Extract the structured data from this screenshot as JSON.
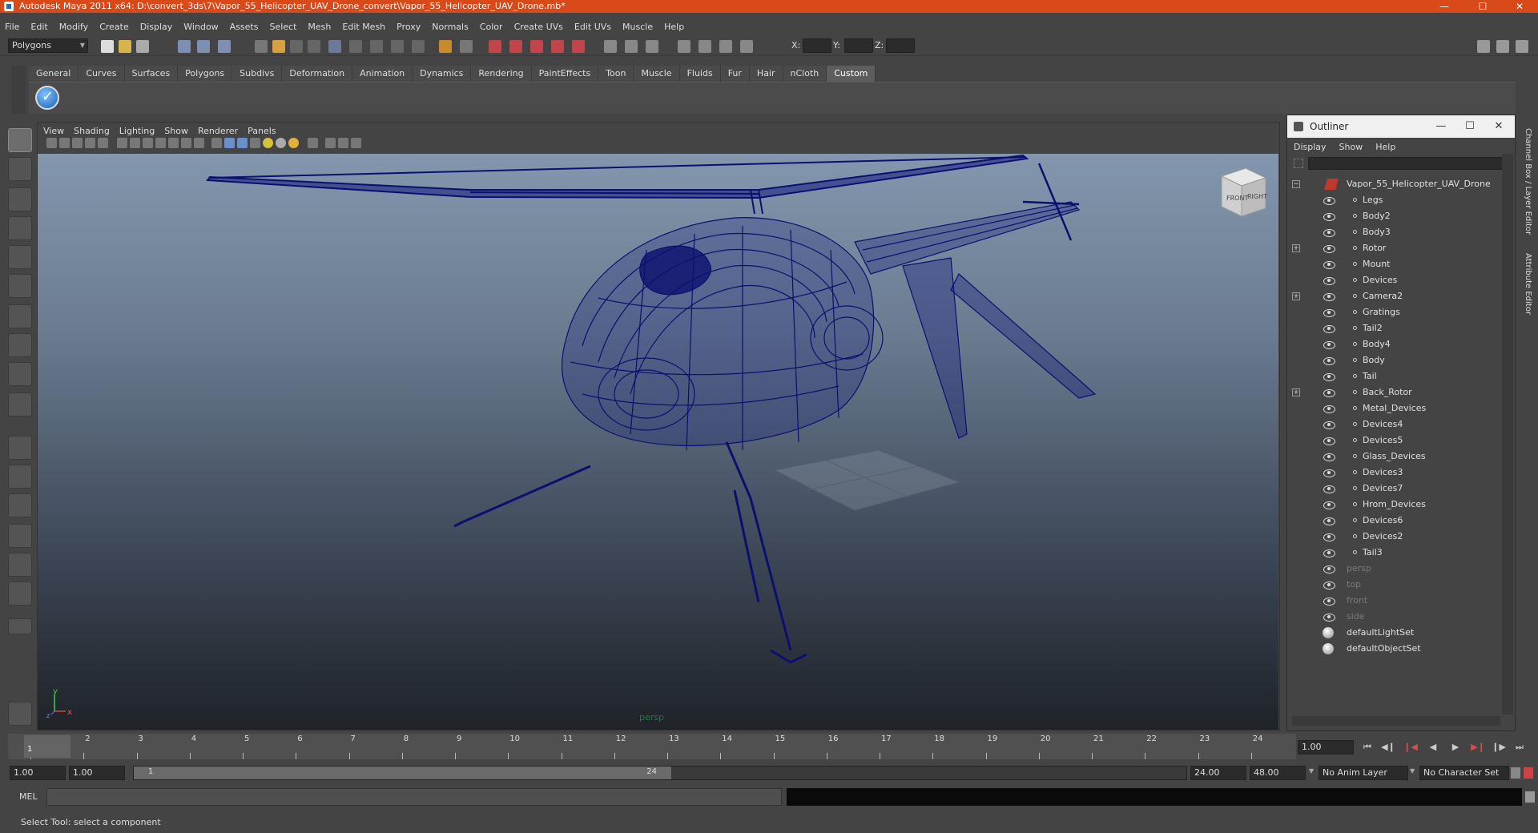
{
  "titlebar": {
    "title": "Autodesk Maya 2011 x64: D:\\convert_3ds\\7\\Vapor_55_Helicopter_UAV_Drone_convert\\Vapor_55_Helicopter_UAV_Drone.mb*",
    "minimize": "—",
    "maximize": "☐",
    "close": "✕"
  },
  "menubar": [
    "File",
    "Edit",
    "Modify",
    "Create",
    "Display",
    "Window",
    "Assets",
    "Select",
    "Mesh",
    "Edit Mesh",
    "Proxy",
    "Normals",
    "Color",
    "Create UVs",
    "Edit UVs",
    "Muscle",
    "Help"
  ],
  "statusline": {
    "mode": "Polygons",
    "x_label": "X:",
    "y_label": "Y:",
    "z_label": "Z:"
  },
  "shelf": {
    "tabs": [
      "General",
      "Curves",
      "Surfaces",
      "Polygons",
      "Subdivs",
      "Deformation",
      "Animation",
      "Dynamics",
      "Rendering",
      "PaintEffects",
      "Toon",
      "Muscle",
      "Fluids",
      "Fur",
      "Hair",
      "nCloth",
      "Custom"
    ],
    "active_tab": "Custom"
  },
  "viewport": {
    "menu": [
      "View",
      "Shading",
      "Lighting",
      "Show",
      "Renderer",
      "Panels"
    ],
    "camera": "persp",
    "viewcube_front": "FRONT",
    "viewcube_right": "RIGHT",
    "axis_y": "y",
    "axis_z": "z",
    "axis_x": "x",
    "wire_color": "#0b0f6e"
  },
  "outliner": {
    "title": "Outliner",
    "menu": [
      "Display",
      "Show",
      "Help"
    ],
    "root": "Vapor_55_Helicopter_UAV_Drone",
    "children": [
      "Legs",
      "Body2",
      "Body3",
      "Rotor",
      "Mount",
      "Devices",
      "Camera2",
      "Gratings",
      "Tail2",
      "Body4",
      "Body",
      "Tail",
      "Back_Rotor",
      "Metal_Devices",
      "Devices4",
      "Devices5",
      "Glass_Devices",
      "Devices3",
      "Devices7",
      "Hrom_Devices",
      "Devices6",
      "Devices2",
      "Tail3"
    ],
    "cameras": [
      "persp",
      "top",
      "front",
      "side"
    ],
    "sets": [
      "defaultLightSet",
      "defaultObjectSet"
    ]
  },
  "rightstrip": {
    "channel_box": "Channel Box / Layer Editor",
    "attribute_editor": "Attribute Editor"
  },
  "timeline": {
    "ticks": [
      "1",
      "2",
      "3",
      "4",
      "5",
      "6",
      "7",
      "8",
      "9",
      "10",
      "11",
      "12",
      "13",
      "14",
      "15",
      "16",
      "17",
      "18",
      "19",
      "20",
      "21",
      "22",
      "23",
      "24"
    ],
    "current_frame": "1.00",
    "playhead": "1"
  },
  "range": {
    "start": "1.00",
    "playback_start": "1.00",
    "slider_start": "1",
    "slider_end": "24",
    "playback_end": "24.00",
    "end": "48.00",
    "anim_layer": "No Anim Layer",
    "character_set": "No Character Set"
  },
  "command": {
    "label": "MEL"
  },
  "helpline": "Select Tool: select a component"
}
